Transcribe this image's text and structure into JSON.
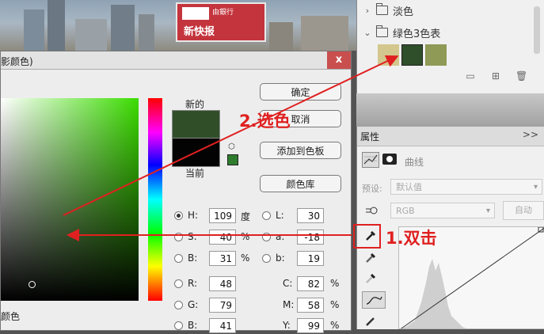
{
  "photo": {
    "billboard_text_top": "由銀行",
    "billboard_text_bottom": "新快报"
  },
  "swatches": {
    "groups": [
      {
        "label": "淡色",
        "expanded": false
      },
      {
        "label": "绿色3色表",
        "expanded": true
      }
    ],
    "colors": [
      "#d4c78d",
      "#2e4f29",
      "#8e9a56"
    ],
    "icons": [
      "new-group-icon",
      "new-swatch-icon",
      "trash-icon"
    ]
  },
  "picker": {
    "title": "影颜色)",
    "close_label": "x",
    "new_label": "新的",
    "current_label": "当前",
    "new_color": "#304f29",
    "current_color": "#030303",
    "buttons": {
      "ok": "确定",
      "cancel": "取消",
      "add": "添加到色板",
      "library": "颜色库"
    },
    "bottom_label": "颜色",
    "fields": {
      "H": {
        "label": "H:",
        "value": "109",
        "unit": "度"
      },
      "S": {
        "label": "S:",
        "value": "40",
        "unit": "%"
      },
      "B": {
        "label": "B:",
        "value": "31",
        "unit": "%"
      },
      "R": {
        "label": "R:",
        "value": "48"
      },
      "G": {
        "label": "G:",
        "value": "79"
      },
      "Bv": {
        "label": "B:",
        "value": "41"
      },
      "L": {
        "label": "L:",
        "value": "30"
      },
      "a": {
        "label": "a:",
        "value": "-18"
      },
      "b": {
        "label": "b:",
        "value": "19"
      },
      "C": {
        "label": "C:",
        "value": "82",
        "unit": "%"
      },
      "M": {
        "label": "M:",
        "value": "58",
        "unit": "%"
      },
      "Y": {
        "label": "Y:",
        "value": "99",
        "unit": "%"
      }
    },
    "selected_mode": "H"
  },
  "properties": {
    "tab": "属性",
    "more": ">>",
    "curves_label": "曲线",
    "preset_label": "预设:",
    "preset_value": "默认值",
    "channel_value": "RGB",
    "auto_label": "自动"
  },
  "annotations": {
    "step1": "1.双击",
    "step2": "2.选色",
    "color": "#e02020"
  }
}
